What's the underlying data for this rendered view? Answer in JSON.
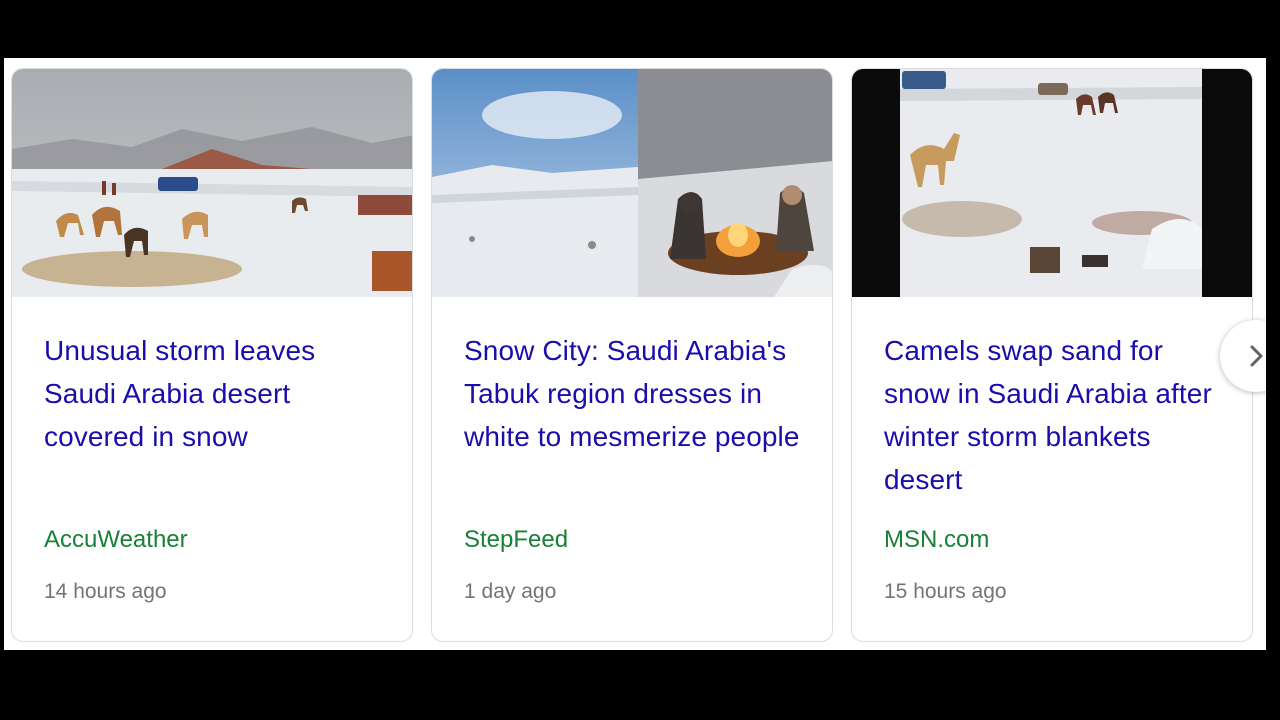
{
  "news_carousel": {
    "cards": [
      {
        "image_alt": "camels in snow-covered desert",
        "title": "Unusual storm leaves Saudi Arabia desert covered in snow",
        "source": "AccuWeather",
        "time": "14 hours ago"
      },
      {
        "image_alt": "snowy landscape and people by a campfire",
        "title": "Snow City: Saudi Arabia's Tabuk region dresses in white to mesmerize people",
        "source": "StepFeed",
        "time": "1 day ago"
      },
      {
        "image_alt": "camels standing in snow",
        "title": "Camels swap sand for snow in Saudi Arabia after winter storm blankets desert",
        "source": "MSN.com",
        "time": "15 hours ago"
      }
    ],
    "next_icon": "chevron-right-icon"
  },
  "colors": {
    "title": "#1a0dab",
    "source": "#188038",
    "time": "#70757a",
    "border": "#dadce0"
  }
}
